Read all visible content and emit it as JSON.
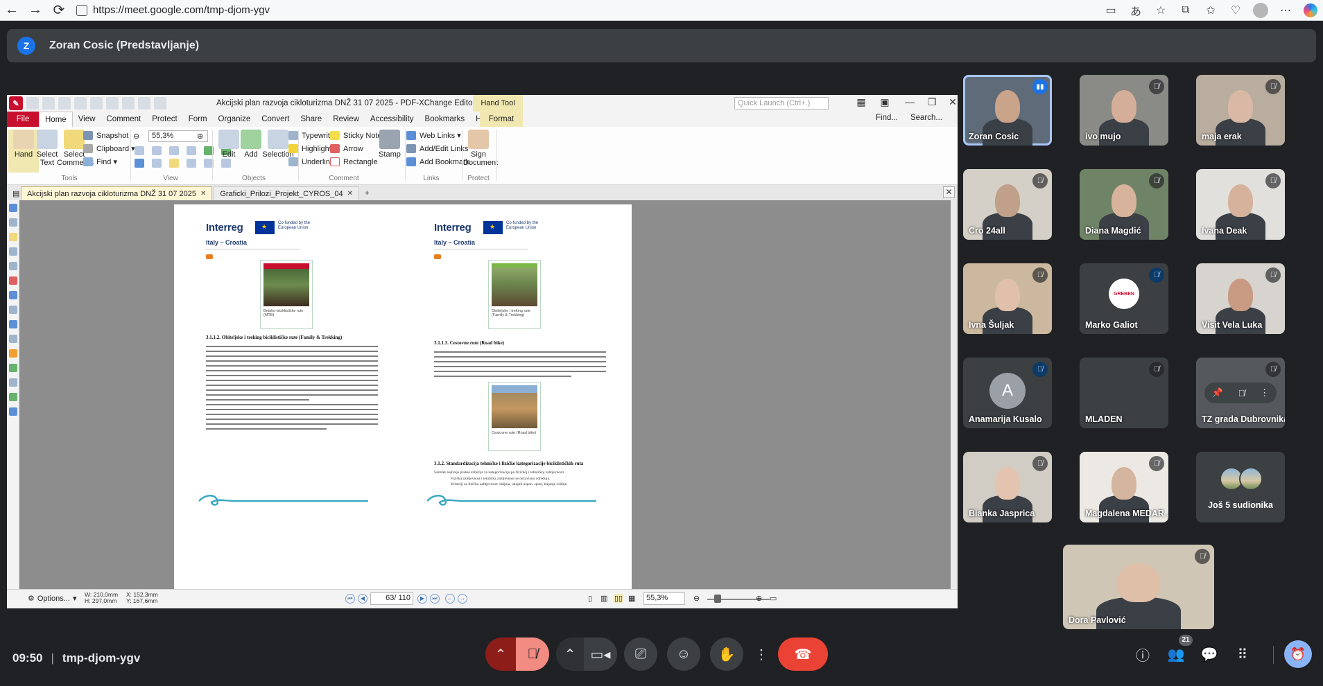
{
  "browser": {
    "url": "https://meet.google.com/tmp-djom-ygv",
    "back_icon": "arrow-left-icon",
    "forward_icon": "arrow-right-icon",
    "reload_icon": "reload-icon"
  },
  "presenter": {
    "initial": "Z",
    "label": "Zoran Cosic (Predstavljanje)"
  },
  "pdf_editor": {
    "window_title": "Akcijski plan razvoja cikloturizma DNŽ 31 07 2025 - PDF-XChange Editor",
    "context_tab_group": "Hand Tool",
    "context_tab": "Format",
    "quick_launch_placeholder": "Quick Launch (Ctrl+.)",
    "menu": [
      "File",
      "Home",
      "View",
      "Comment",
      "Protect",
      "Form",
      "Organize",
      "Convert",
      "Share",
      "Review",
      "Accessibility",
      "Bookmarks",
      "Help"
    ],
    "menu_right": [
      "Find...",
      "Search..."
    ],
    "ribbon": {
      "hand": "Hand",
      "select_text": "Select Text",
      "select_comments": "Select Comments",
      "snapshot": "Snapshot",
      "clipboard": "Clipboard",
      "find": "Find",
      "group_tools": "Tools",
      "zoom_value": "55,3%",
      "group_view": "View",
      "edit": "Edit",
      "add": "Add",
      "selection": "Selection",
      "group_objects": "Objects",
      "typewriter": "Typewriter",
      "sticky_note": "Sticky Note",
      "highlight": "Highlight",
      "arrow": "Arrow",
      "underline": "Underline",
      "rectangle": "Rectangle",
      "group_comment": "Comment",
      "stamp": "Stamp",
      "web_links": "Web Links",
      "add_edit_links": "Add/Edit Links",
      "add_bookmark": "Add Bookmark",
      "group_links": "Links",
      "sign_document": "Sign Document",
      "group_protect": "Protect"
    },
    "tabs": [
      {
        "label": "Akcijski plan razvoja cikloturizma DNŽ 31 07 2025"
      },
      {
        "label": "Graficki_Prilozi_Projekt_CYROS_04"
      }
    ],
    "pages": [
      {
        "logo": "interreg",
        "eu_text": "Co-funded by the European Union",
        "country": "Italy – Croatia",
        "photo_caption": "Brdsko-biciklističke rute (MTB)",
        "heading": "3.1.1.2. Obiteljske i treking biciklističke rute (Family & Trekking)",
        "text_lines": 18
      },
      {
        "logo": "interreg",
        "eu_text": "Co-funded by the European Union",
        "country": "Italy – Croatia",
        "photo_caption_1": "Obiteljske i treking rute (Family & Trekking)",
        "heading_1": "3.1.1.3. Cestovne rute (Road bike)",
        "text_lines_1": 6,
        "photo_caption_2": "Cestovne rute (Road bike)",
        "heading_2": "3.1.2. Standardizacija tehničke i fizičke kategorizacije biciklističkih ruta",
        "intro": "Sažetak najbolje prakse kriterija za kategorizaciju po fizičkoj i tehničkoj zahtjevnosti",
        "bullets": [
          "Fizička zahtjevnost i tehnička zahtjevnost se nezavisno određuju.",
          "Kriteriji za fizičku zahtjevnost: duljina, ukupni uspon, spust, trajanje vožnje."
        ]
      }
    ],
    "status": {
      "options": "Options...",
      "w": "W: 210,0mm",
      "h": "H: 297,0mm",
      "x": "X: 152,3mm",
      "y": "Y: 167,6mm",
      "page": "63",
      "page_total": "/ 110",
      "zoom": "55,3%"
    }
  },
  "participants": [
    {
      "name": "Zoran Cosic",
      "speaking": true,
      "skin": "#c9a38a",
      "bg": "#5f6b78"
    },
    {
      "name": "ivo mujo",
      "skin": "#d4ae98",
      "bg": "#8a8a86"
    },
    {
      "name": "maja erak",
      "skin": "#d9b9a6",
      "bg": "#b8ad9e"
    },
    {
      "name": "Cro 24all",
      "skin": "#c0a088",
      "bg": "#d5d0c7"
    },
    {
      "name": "Diana Magdić",
      "skin": "#d8b39b",
      "bg": "#6f8466"
    },
    {
      "name": "Ivana Deak",
      "skin": "#d6b29c",
      "bg": "#e2e0dc"
    },
    {
      "name": "Ivna Šuljak",
      "skin": "#e0c0aa",
      "bg": "#cbb89f"
    },
    {
      "name": "Marko Galiot",
      "logo_text": "GREBEN"
    },
    {
      "name": "Visit Vela Luka",
      "skin": "#c99a82",
      "bg": "#d7d4cf"
    },
    {
      "name": "Anamarija Kusalo",
      "avatar": "A"
    },
    {
      "name": "MLADEN",
      "blank": true
    },
    {
      "name": "TZ grada Dubrovnika",
      "hover": true
    },
    {
      "name": "Bianka Jasprica",
      "skin": "#e3c4b0",
      "bg": "#d2cdc4"
    },
    {
      "name": "Magdalena MEDAR ...",
      "skin": "#d5b59f",
      "bg": "#ece9e4"
    },
    {
      "more": "Još 5 sudionika"
    },
    {
      "name": "Dora Pavlović",
      "skin": "#dfbfa8",
      "bg": "#cfc6b5"
    }
  ],
  "bottom": {
    "time": "09:50",
    "meeting_code": "tmp-djom-ygv",
    "people_count": "21"
  },
  "colors": {
    "meet_bg": "#202124",
    "tile_bg": "#3c4043",
    "hangup": "#ea4335",
    "mic_off_red": "#f28b82",
    "accent_blue": "#8ab4f8",
    "pdf_red": "#c8102e"
  }
}
